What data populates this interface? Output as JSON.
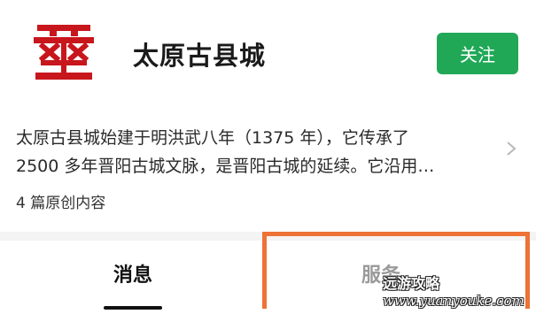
{
  "account": {
    "name": "太原古县城",
    "follow_label": "关注",
    "logo_icon": "red-heritage-emblem-icon",
    "intro_lines": [
      "太原古县城始建于明洪武八年（1375 年），它传承了",
      "2500 多年晋阳古城文脉，是晋阳古城的延续。它沿用…"
    ],
    "article_count": "4 篇原创内容"
  },
  "tabs": [
    {
      "label": "消息",
      "active": true
    },
    {
      "label": "服务",
      "active": false
    }
  ],
  "watermark": {
    "title": "远游攻略",
    "site": "www.yuanyouke.com"
  },
  "colors": {
    "follow_button": "#21a857",
    "logo_red": "#c8161d",
    "highlight_border": "#ee7135",
    "active_tab": "#111111",
    "inactive_tab": "#9a9a9a"
  }
}
